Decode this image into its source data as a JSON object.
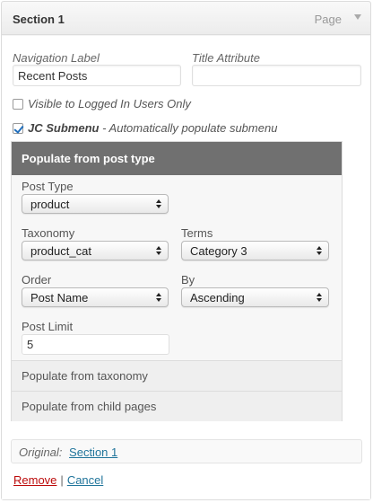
{
  "item": {
    "title": "Section 1",
    "type_label": "Page"
  },
  "fields": {
    "navigation_label": {
      "label": "Navigation Label",
      "value": "Recent Posts"
    },
    "title_attribute": {
      "label": "Title Attribute",
      "value": ""
    },
    "visible_logged_in": {
      "label": "Visible to Logged In Users Only",
      "checked": false
    },
    "jc_submenu": {
      "label_bold": "JC Submenu",
      "label_rest": " - Automatically populate submenu",
      "checked": true
    }
  },
  "panel": {
    "header": "Populate from post type",
    "post_type": {
      "label": "Post Type",
      "value": "product"
    },
    "taxonomy": {
      "label": "Taxonomy",
      "value": "product_cat"
    },
    "terms": {
      "label": "Terms",
      "value": "Category 3"
    },
    "order": {
      "label": "Order",
      "value": "Post Name"
    },
    "by": {
      "label": "By",
      "value": "Ascending"
    },
    "post_limit": {
      "label": "Post Limit",
      "value": "5"
    },
    "sections": [
      "Populate from taxonomy",
      "Populate from child pages"
    ]
  },
  "original": {
    "label": "Original:",
    "link": "Section 1"
  },
  "actions": {
    "remove": "Remove",
    "separator": "|",
    "cancel": "Cancel"
  }
}
